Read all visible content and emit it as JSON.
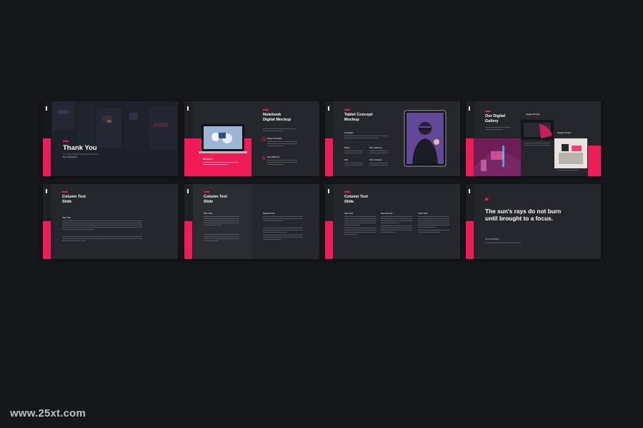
{
  "page": {
    "background": "#16171a",
    "accent": "#f01c58"
  },
  "watermark": "www.25xt.com",
  "slides": {
    "thank_you": {
      "title": "Thank You",
      "subtitle": "It is a long established fact that a reader will be",
      "byline": "Don'a Mu Ravilson"
    },
    "notebook": {
      "title": "Notebook\nDigital Mockup",
      "item1": "Itemy Concepts",
      "item2": "Item Website",
      "caption": "Marketplace"
    },
    "tablet": {
      "title": "Tablet Concept\nMockup",
      "label1": "Concepts",
      "label2": "Rindo",
      "label3": "Info Advisory",
      "label4": "Info",
      "label5": "Info Advisory"
    },
    "gallery": {
      "title": "Our Digital\nGallery",
      "label1": "Image Preview",
      "label2": "Image Preview"
    },
    "column1": {
      "title": "Column Text\nSlide",
      "heading": "Title Text"
    },
    "column2": {
      "title": "Column Text\nSlide",
      "heading1": "Title Text",
      "heading2": "Second Text"
    },
    "column3": {
      "title": "Column Text\nSlide",
      "heading1": "Title Text",
      "heading2": "Second Text",
      "heading3": "Third Text"
    },
    "quote": {
      "mark": "❝",
      "text": "The sun's rays do not burn until brought to a focus.",
      "author": "Don'a Mu Ravilson"
    }
  }
}
